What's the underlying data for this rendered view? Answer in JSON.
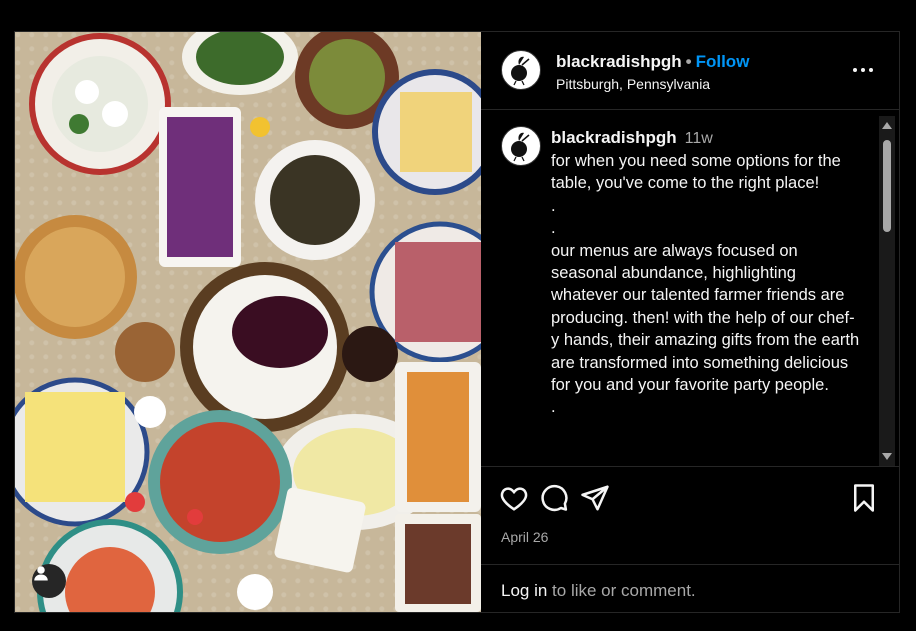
{
  "post": {
    "username": "blackradishpgh",
    "separator": "•",
    "follow_label": "Follow",
    "location": "Pittsburgh, Pennsylvania",
    "time_ago": "11w",
    "caption": "for when you need some options for the table, you've come to the right place!\n.\n.\nour menus are always focused on seasonal abundance, highlighting whatever our talented farmer friends are producing. then! with the help of our chef-y hands, their amazing gifts from the earth are transformed into something delicious for you and your favorite party people.\n.",
    "date": "April 26",
    "login_link": "Log in",
    "login_suffix": " to like or comment."
  },
  "icons": {
    "more": "more-options-icon",
    "like": "heart-icon",
    "comment": "comment-icon",
    "share": "share-icon",
    "save": "bookmark-icon",
    "user_tag": "user-tag-icon"
  },
  "colors": {
    "background": "#000000",
    "follow": "#0095f6",
    "muted": "#a8a8a8",
    "border": "#262626"
  }
}
